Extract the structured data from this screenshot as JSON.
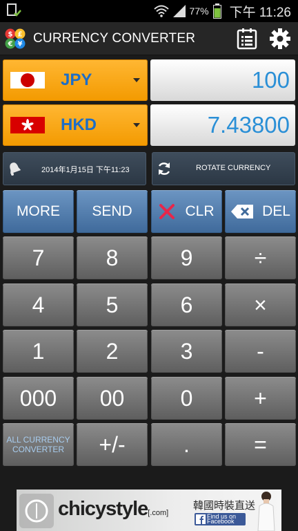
{
  "status_bar": {
    "battery": "77%",
    "time": "下午 11:26",
    "icons": [
      "download-done-icon",
      "wifi-icon",
      "signal-icon",
      "battery-icon"
    ]
  },
  "app": {
    "title": "CURRENCY CONVERTER",
    "icons": [
      "app-logo-icon",
      "calendar-list-icon",
      "gear-icon"
    ]
  },
  "currencies": [
    {
      "code": "JPY",
      "flag": "japan-flag-icon",
      "value": "100"
    },
    {
      "code": "HKD",
      "flag": "hong-kong-flag-icon",
      "value": "7.43800"
    }
  ],
  "info": {
    "date": "2014年1月15日 下午11:23",
    "rotate_label": "ROTATE CURRENCY"
  },
  "actions": {
    "more": "MORE",
    "send": "SEND",
    "clear": "CLR",
    "delete": "DEL"
  },
  "keys": {
    "row1": [
      "7",
      "8",
      "9",
      "÷"
    ],
    "row2": [
      "4",
      "5",
      "6",
      "×"
    ],
    "row3": [
      "1",
      "2",
      "3",
      "-"
    ],
    "row4": [
      "000",
      "00",
      "0",
      "+"
    ],
    "row5": [
      "ALL CURRENCY CONVERTER",
      "+/-",
      ".",
      "="
    ]
  },
  "ad": {
    "brand": "chicystyle",
    "brand_suffix": "[.com]",
    "tagline": "韓國時裝直送",
    "facebook_text": "Find us on Facebook"
  },
  "colors": {
    "accent_orange": "#f39a00",
    "value_blue": "#2a8fd6",
    "action_blue": "#4f7aa8",
    "key_gray": "#6e6e6e",
    "clear_red": "#e8264a"
  }
}
